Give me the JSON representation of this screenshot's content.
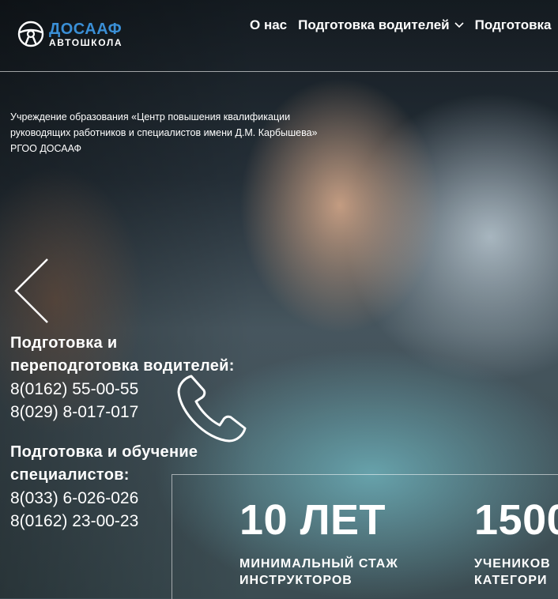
{
  "brand": {
    "title": "ДОСААФ",
    "subtitle": "АВТОШКОЛА",
    "accent_color": "#3a8fd6",
    "icon": "steering-wheel-icon"
  },
  "nav": {
    "items": [
      {
        "label": "О нас"
      },
      {
        "label": "Подготовка водителей",
        "has_dropdown": true
      },
      {
        "label": "Подготовка"
      }
    ]
  },
  "hero": {
    "org_name": "Учреждение образования «Центр повышения квалификации руководящих работников и специалистов имени Д.М. Карбышева» РГОО ДОСААФ",
    "prev_icon": "chevron-left-icon",
    "phone_icon": "phone-icon",
    "contacts": [
      {
        "title": "Подготовка и переподготовка водителей:",
        "phones": [
          "8(0162) 55-00-55",
          "8(029) 8-017-017"
        ]
      },
      {
        "title": "Подготовка и обучение специалистов:",
        "phones": [
          "8(033) 6-026-026",
          "8(0162) 23-00-23"
        ]
      }
    ]
  },
  "stats": [
    {
      "value": "10 ЛЕТ",
      "label": "МИНИМАЛЬНЫЙ СТАЖ\nИНСТРУКТОРОВ"
    },
    {
      "value": "1500",
      "label": "УЧЕНИКОВ\nКАТЕГОРИ"
    }
  ]
}
